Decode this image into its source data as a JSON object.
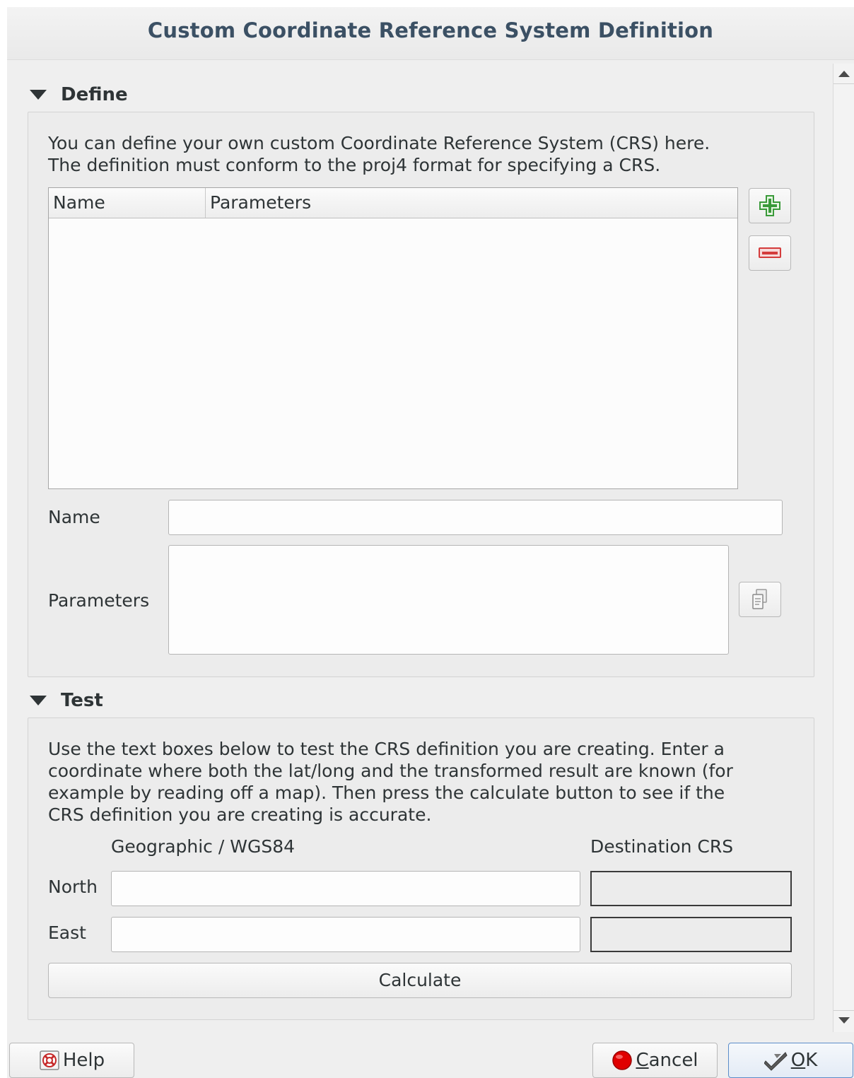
{
  "window": {
    "title": "Custom Coordinate Reference System Definition"
  },
  "define": {
    "header": "Define",
    "description_line1": "You can define your own custom Coordinate Reference System (CRS) here.",
    "description_line2": "The definition must conform to the proj4 format for specifying a CRS.",
    "table": {
      "columns": [
        "Name",
        "Parameters"
      ],
      "rows": []
    },
    "add_icon": "add-plus-icon",
    "remove_icon": "remove-minus-icon",
    "name_label": "Name",
    "name_value": "",
    "parameters_label": "Parameters",
    "parameters_value": "",
    "copy_icon": "copy-parameters-icon"
  },
  "test": {
    "header": "Test",
    "description_lines": [
      "Use the text boxes below to test the CRS definition you are creating. Enter a",
      "coordinate where both the lat/long and the transformed result are known (for",
      "example by reading off a map). Then press the calculate button to see if the",
      "CRS definition you are creating is accurate."
    ],
    "geographic_header": "Geographic / WGS84",
    "destination_header": "Destination CRS",
    "north_label": "North",
    "east_label": "East",
    "north_value": "",
    "east_value": "",
    "dest_north_value": "",
    "dest_east_value": "",
    "calculate_label": "Calculate"
  },
  "buttons": {
    "help_label": "Help",
    "cancel_label_first": "C",
    "cancel_label_rest": "ancel",
    "ok_label_first": "O",
    "ok_label_rest": "K"
  },
  "colors": {
    "add_green": "#3a9a3a",
    "remove_red": "#d43c3c",
    "cancel_red": "#e00000",
    "title_blue": "#3b5064"
  }
}
